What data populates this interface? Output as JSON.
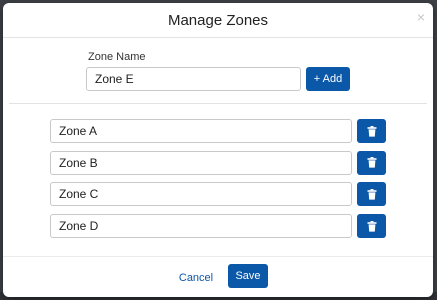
{
  "modal": {
    "title": "Manage Zones",
    "close_symbol": "×"
  },
  "new_zone": {
    "label": "Zone Name",
    "value": "Zone E",
    "add_button_label": "+ Add"
  },
  "zones": [
    {
      "name": "Zone A",
      "delete_icon": "trash-icon"
    },
    {
      "name": "Zone B",
      "delete_icon": "trash-icon"
    },
    {
      "name": "Zone C",
      "delete_icon": "trash-icon"
    },
    {
      "name": "Zone D",
      "delete_icon": "trash-icon"
    }
  ],
  "footer": {
    "cancel_label": "Cancel",
    "save_label": "Save"
  },
  "colors": {
    "primary": "#0b57a8",
    "backdrop": "#3e4146",
    "surface": "#ffffff"
  }
}
